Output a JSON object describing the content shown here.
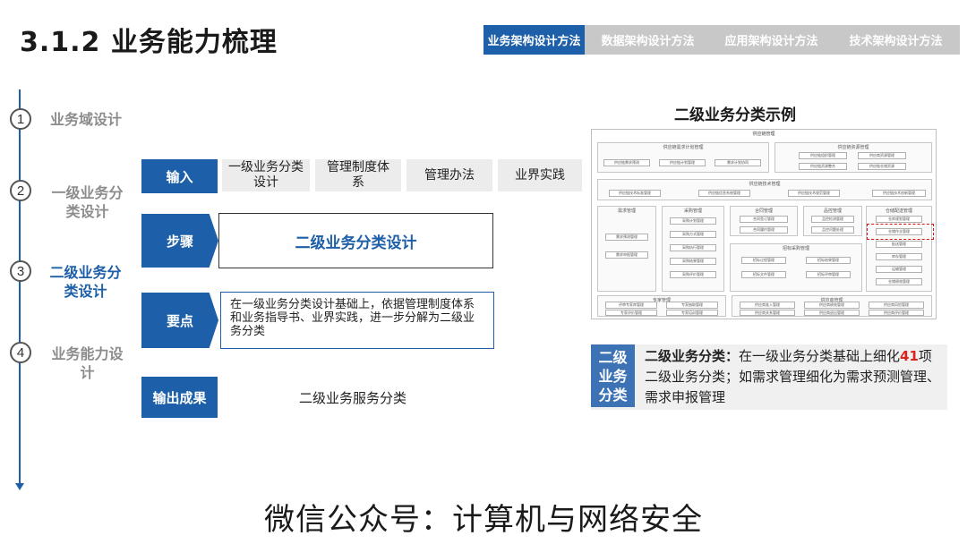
{
  "title": "3.1.2 业务能力梳理",
  "tabs": [
    "业务架构设计方法",
    "数据架构设计方法",
    "应用架构设计方法",
    "技术架构设计方法"
  ],
  "steps": [
    {
      "num": "1",
      "label": "业务域设计"
    },
    {
      "num": "2",
      "label": "一级业务分\n类设计"
    },
    {
      "num": "3",
      "label": "二级业务分\n类设计"
    },
    {
      "num": "4",
      "label": "业务能力设\n计"
    }
  ],
  "flow": {
    "input_label": "输入",
    "inputs": [
      "一级业务分类\n设计",
      "管理制度体\n系",
      "管理办法",
      "业界实践"
    ],
    "step_label": "步骤",
    "step_text": "二级业务分类设计",
    "key_label": "要点",
    "key_text": "在一级业务分类设计基础上，依据管理制度体系和业务指导书、业界实践，进一步分解为二级业务分类",
    "output_label": "输出成果",
    "output_text": "二级业务服务分类"
  },
  "example": {
    "title": "二级业务分类示例",
    "diagram_top": "供应链管理",
    "blocks": {
      "b1": "供应链需求计划管理",
      "b2": "供应链资源管理",
      "b3": "供应链技术管理",
      "b4": "需求管理",
      "b5": "采购管理",
      "b6": "合同管理",
      "b7": "品控管理",
      "b8": "仓储配送管理",
      "b9": "招标采购管理",
      "b10": "物资质量管理",
      "b11": "专家管理",
      "b12": "供应商管理"
    },
    "cells": {
      "c1": "供应链需求预测",
      "c2": "供应链计划管理",
      "c3": "需求计划协同",
      "c4": "供应链组织管理",
      "c5": "供应商资源管理",
      "c6": "供应链资源整合",
      "c7": "供应链仓储资源",
      "c8": "供应链技术标准管理",
      "c9": "供应链信息系统管理",
      "c10": "供应链技术规范管理",
      "c11": "供应链技术创新管理",
      "c12": "需求预测管理",
      "c13": "需求申报管理",
      "c14": "采购计划管理",
      "c15": "采购方式管理",
      "c16": "采购执行管理",
      "c17": "采购结果管理",
      "c18": "采购评价管理",
      "c19": "合同签订管理",
      "c20": "合同履约管理",
      "c21": "品控检测管理",
      "c22": "品控问题处理",
      "c23": "仓库规划管理",
      "c24": "仓储作业管理",
      "c25": "配送管理",
      "c26": "库存管理",
      "c27": "运输管理",
      "c28": "仓储绩效管理",
      "c29": "招标过程管理",
      "c30": "招标结果管理",
      "c31": "招标文件管理",
      "c32": "招标评审管理",
      "c33": "评审专家库管理",
      "c34": "专家抽取管理",
      "c35": "专家评价管理",
      "c36": "专家培训管理",
      "c37": "供应商准入管理",
      "c38": "供应商绩效管理",
      "c39": "供应商风险管理",
      "c40": "供应商关系管理",
      "c41": "供应商退出管理",
      "c42": "供应商评价管理"
    },
    "cat_tag": "二级\n业务\n分类",
    "cat_lead": "二级业务分类：",
    "cat_pre": "在一级业务分类基础上细化",
    "cat_num": "41",
    "cat_post": "项二级业务分类；如需求管理细化为需求预测管理、需求申报管理"
  },
  "footer": "微信公众号：计算机与网络安全"
}
